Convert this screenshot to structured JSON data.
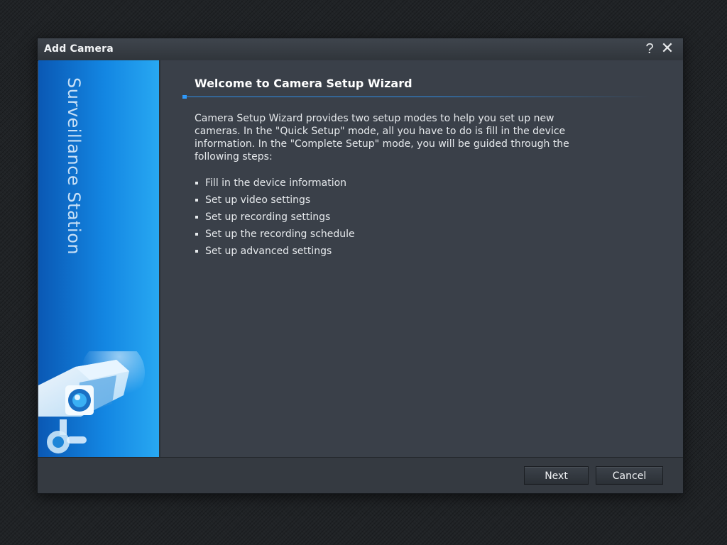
{
  "window": {
    "title": "Add Camera",
    "help_label": "?",
    "close_label": "✕"
  },
  "sidebar": {
    "brand_text": "Surveillance Station"
  },
  "main": {
    "heading": "Welcome to Camera Setup Wizard",
    "description": "Camera Setup Wizard provides two setup modes to help you set up new cameras. In the \"Quick Setup\" mode, all you have to do is fill in the device information. In the \"Complete Setup\" mode, you will be guided through the following steps:",
    "steps": [
      "Fill in the device information",
      "Set up video settings",
      "Set up recording settings",
      "Set up the recording schedule",
      "Set up advanced settings"
    ]
  },
  "footer": {
    "next_label": "Next",
    "cancel_label": "Cancel"
  },
  "colors": {
    "accent": "#2d8ee8",
    "dialog_bg": "#3a4049",
    "sidebar_blue": "#1386e2"
  }
}
